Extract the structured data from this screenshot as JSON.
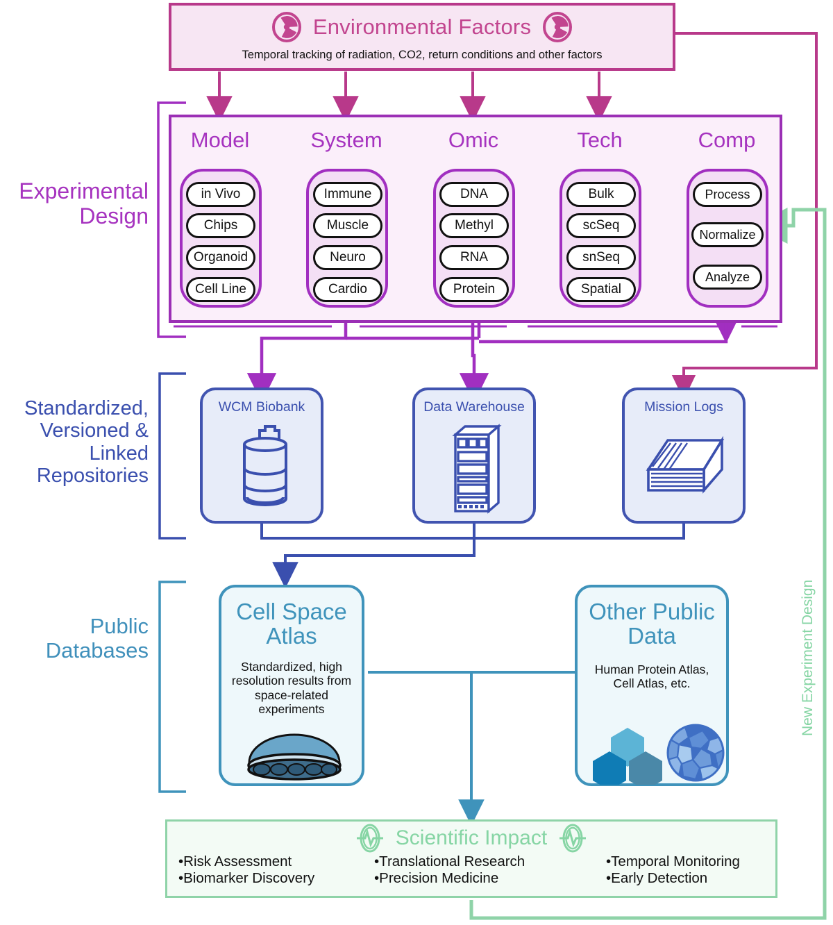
{
  "environmental": {
    "title": "Environmental Factors",
    "subtitle": "Temporal tracking of radiation, CO2, return conditions and other factors",
    "icon_left": "radiation-icon",
    "icon_right": "radiation-icon",
    "accent": "#b8398a"
  },
  "sections": {
    "experimental_design": "Experimental Design",
    "repositories": "Standardized, Versioned & Linked Repositories",
    "public_databases": "Public Databases",
    "feedback_loop": "New Experiment Design"
  },
  "experimental_design": {
    "accent": "#a633bf",
    "columns": [
      {
        "header": "Model",
        "items": [
          "in Vivo",
          "Chips",
          "Organoid",
          "Cell Line"
        ]
      },
      {
        "header": "System",
        "items": [
          "Immune",
          "Muscle",
          "Neuro",
          "Cardio"
        ]
      },
      {
        "header": "Omic",
        "items": [
          "DNA",
          "Methyl",
          "RNA",
          "Protein"
        ]
      },
      {
        "header": "Tech",
        "items": [
          "Bulk",
          "scSeq",
          "snSeq",
          "Spatial"
        ]
      },
      {
        "header": "Comp",
        "items": [
          "Process",
          "Normalize",
          "Analyze"
        ]
      }
    ],
    "highlighted_path": [
      "Cell Line",
      "Muscle",
      "RNA",
      "Bulk",
      "Process",
      "Normalize",
      "Analyze"
    ]
  },
  "repositories": {
    "accent": "#3a4fae",
    "items": [
      {
        "label": "WCM Biobank",
        "icon": "sample-vial-icon"
      },
      {
        "label": "Data Warehouse",
        "icon": "server-rack-icon"
      },
      {
        "label": "Mission Logs",
        "icon": "document-stack-icon"
      }
    ]
  },
  "public_databases": {
    "accent": "#3f93bb",
    "cards": [
      {
        "title_line1": "Cell Space",
        "title_line2": "Atlas",
        "description": "Standardized, high resolution results from space-related experiments",
        "icon": "petri-dish-icon"
      },
      {
        "title_line1": "Other Public",
        "title_line2": "Data",
        "description": "Human Protein Atlas, Cell Atlas, etc.",
        "icon_primary": "hexagon-cluster-icon",
        "icon_secondary": "cell-mosaic-icon"
      }
    ]
  },
  "scientific_impact": {
    "title": "Scientific Impact",
    "accent": "#86d5a4",
    "icon_left": "pulse-icon",
    "icon_right": "pulse-icon",
    "columns": [
      [
        "•Risk Assessment",
        "•Biomarker Discovery"
      ],
      [
        "•Translational Research",
        "•Precision Medicine"
      ],
      [
        "•Temporal Monitoring",
        "•Early Detection"
      ]
    ]
  }
}
